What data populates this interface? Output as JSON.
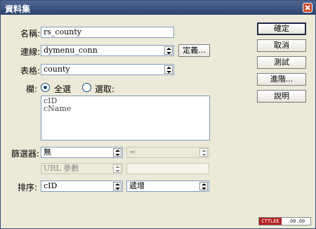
{
  "window": {
    "title": "資料集"
  },
  "form": {
    "name_label": "名稱:",
    "name_value": "rs_county",
    "connection_label": "連線:",
    "connection_value": "dymenu_conn",
    "define_button": "定義...",
    "table_label": "表格:",
    "table_value": "county",
    "columns_label": "欄:",
    "all_label": "全選",
    "select_label": "選取:",
    "columns_list": [
      "cID",
      "cName"
    ],
    "filter_label": "篩選器:",
    "filter_value": "無",
    "operator_value": "=",
    "url_param_value": "URL 參數",
    "url_param_input": "",
    "sort_label": "排序:",
    "sort_value": "cID",
    "order_value": "遞增"
  },
  "buttons": {
    "ok": "確定",
    "cancel": "取消",
    "test": "測試",
    "advanced": "進階...",
    "help": "說明"
  },
  "badge": {
    "left": "CTTLEE",
    "right": ".00.00"
  }
}
